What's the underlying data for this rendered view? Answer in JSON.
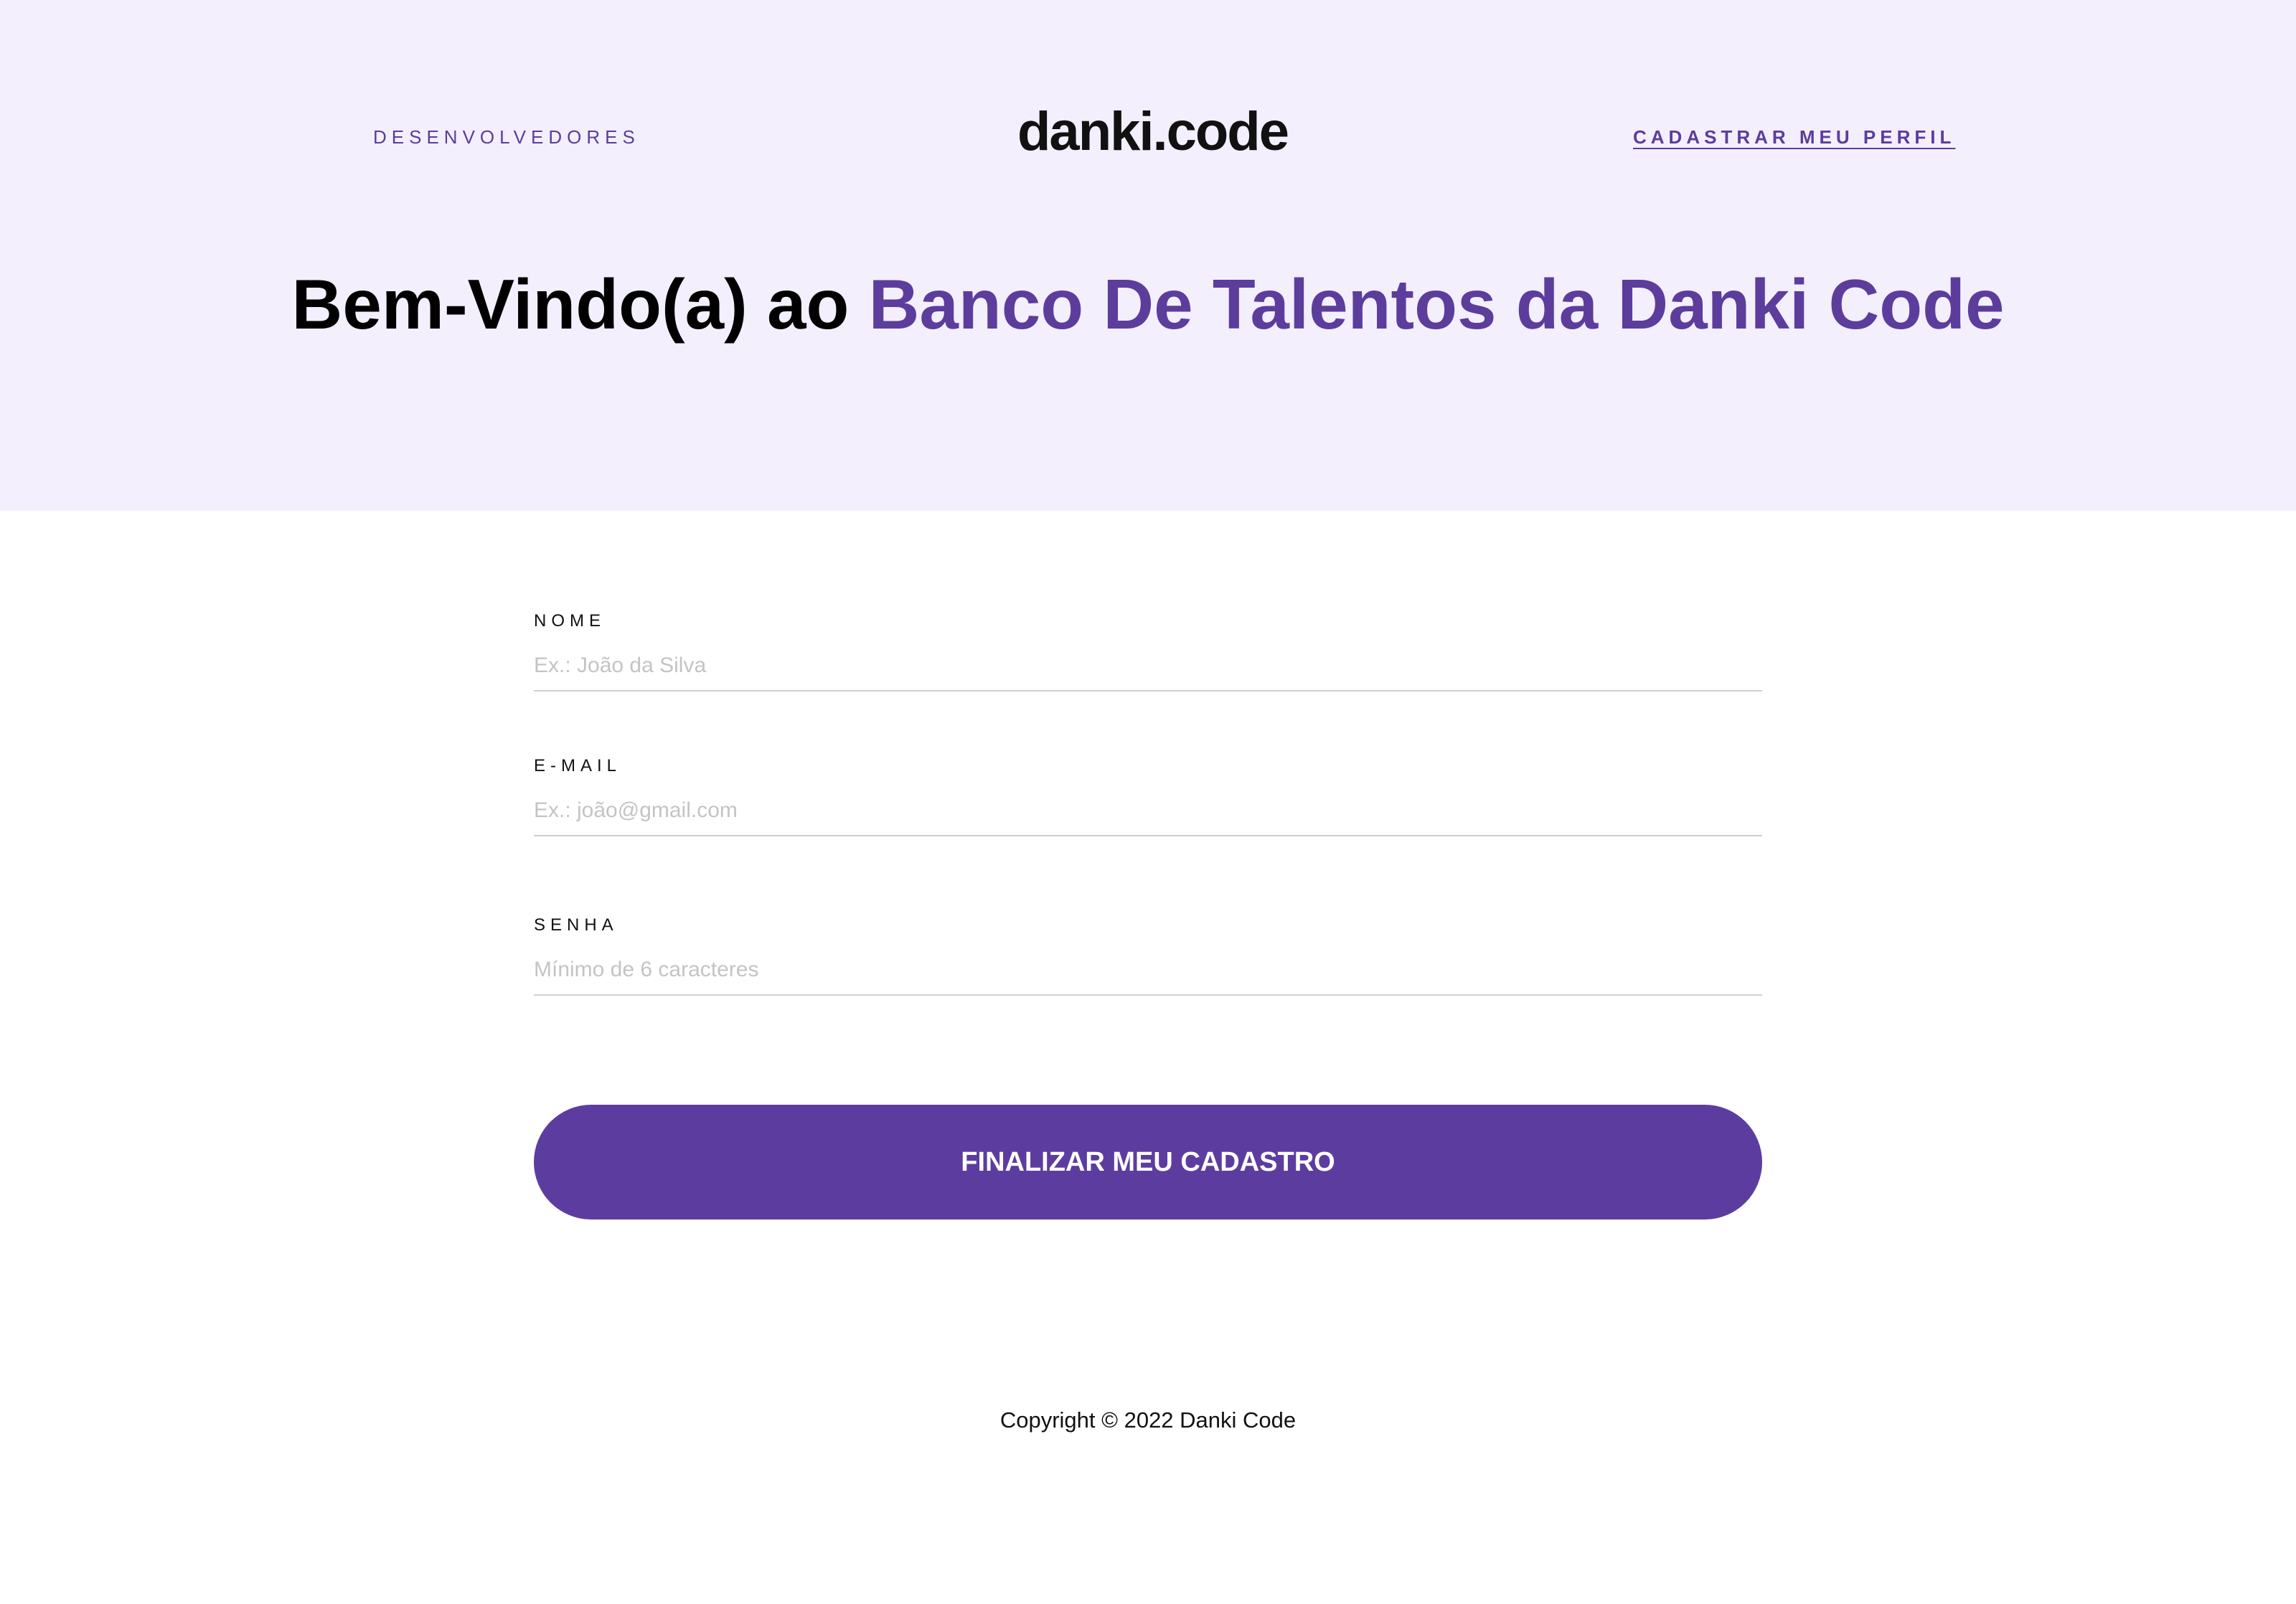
{
  "nav": {
    "left_link": "DESENVOLVEDORES",
    "logo": "danki.code",
    "right_link": "CADASTRAR MEU PERFIL"
  },
  "hero": {
    "title_plain": "Bem-Vindo(a) ao ",
    "title_accent": "Banco De Talentos da Danki Code"
  },
  "form": {
    "name_label": "NOME",
    "name_placeholder": "Ex.: João da Silva",
    "email_label": "E-MAIL",
    "email_placeholder": "Ex.: joão@gmail.com",
    "password_label": "SENHA",
    "password_placeholder": "Mínimo de 6 caracteres",
    "submit_label": "FINALIZAR MEU CADASTRO"
  },
  "footer": {
    "copyright": "Copyright © 2022  Danki Code"
  },
  "colors": {
    "hero_background": "#f3effd",
    "accent": "#5c3d9c",
    "button": "#5c3d9f"
  }
}
